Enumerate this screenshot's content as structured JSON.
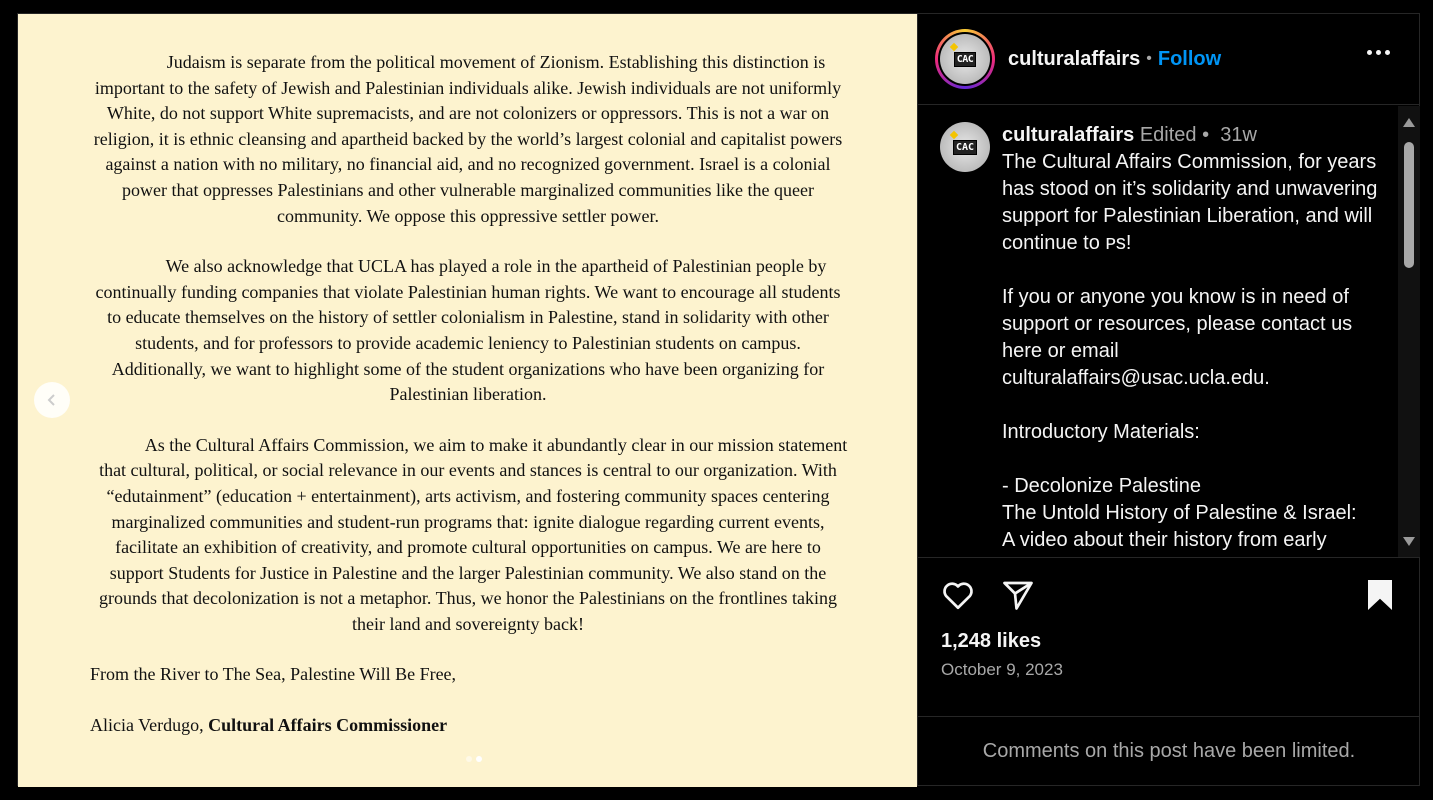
{
  "post_image": {
    "paragraphs": [
      "Judaism is separate from the political movement of Zionism. Establishing this distinction is important to the safety of Jewish and Palestinian individuals alike. Jewish individuals are not uniformly White, do not support White supremacists, and are not colonizers or oppressors. This is not a war on religion, it is ethnic cleansing and apartheid backed by the world’s largest colonial and capitalist powers against a nation with no military, no financial aid, and no recognized government. Israel is a colonial power that oppresses Palestinians and other vulnerable marginalized communities like the queer community. We oppose this oppressive settler power.",
      "We also acknowledge that UCLA has played a role in the apartheid of Palestinian people by continually funding companies that violate Palestinian human rights. We want to encourage all students to educate themselves on the history of settler colonialism in Palestine, stand in solidarity with other students, and for professors to provide academic leniency to Palestinian students on campus. Additionally, we want to highlight some of the student organizations who have been organizing for Palestinian liberation.",
      "As the Cultural Affairs Commission, we aim to make it abundantly clear in our mission statement that cultural, political, or social relevance in our events and stances is central to our organization. With “edutainment” (education + entertainment), arts activism, and fostering community spaces centering marginalized communities and student-run programs that: ignite dialogue regarding current events, facilitate an exhibition of creativity, and promote cultural opportunities on campus. We are here to support Students for Justice in Palestine and the larger Palestinian community. We also stand on the grounds that decolonization is not a metaphor. Thus, we honor the Palestinians on the frontlines taking their land and sovereignty back!"
    ],
    "closing": "From the River to The Sea, Palestine Will Be Free,",
    "signature_name": "Alicia Verdugo, ",
    "signature_title": "Cultural Affairs Commissioner"
  },
  "header": {
    "avatar_text": "CAC",
    "username": "culturalaffairs",
    "separator": "•",
    "follow_label": "Follow"
  },
  "caption": {
    "username": "culturalaffairs",
    "edited": "Edited",
    "dot": "•",
    "age": "31w",
    "text": "The Cultural Affairs Commission, for years has stood on it’s solidarity and unwavering support for Palestinian Liberation, and will continue to ᴘs!\n\nIf you or anyone you know is in need of support or resources, please contact us here or email culturalaffairs@usac.ucla.edu.\n\nIntroductory Materials:\n\n- Decolonize Palestine\nThe Untold History of Palestine & Israel:\nA video about their history from early"
  },
  "stats": {
    "likes": "1,248 likes",
    "date": "October 9, 2023"
  },
  "footer": {
    "comments_limited": "Comments on this post have been limited."
  },
  "colors": {
    "accent": "#0095f6",
    "paper": "#fdf3cf",
    "background": "#000000"
  },
  "icons": [
    "chevron-left-icon",
    "more-icon",
    "heart-icon",
    "share-icon",
    "bookmark-icon"
  ]
}
